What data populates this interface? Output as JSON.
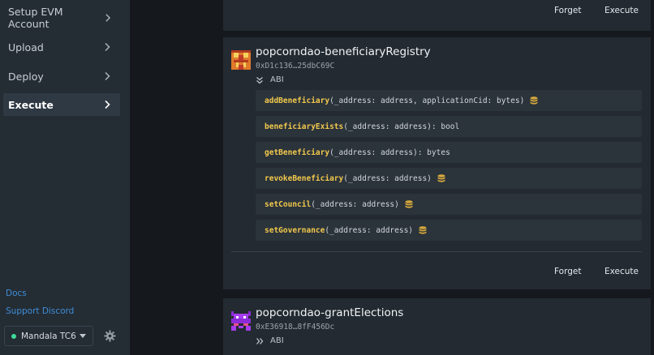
{
  "sidebar": {
    "nav": [
      {
        "label": "Setup EVM Account",
        "active": false
      },
      {
        "label": "Upload",
        "active": false
      },
      {
        "label": "Deploy",
        "active": false
      },
      {
        "label": "Execute",
        "active": true
      }
    ],
    "links": [
      "Docs",
      "Support Discord"
    ],
    "network": {
      "selected": "Mandala TC6"
    }
  },
  "actions": {
    "forget": "Forget",
    "execute": "Execute"
  },
  "contracts": [
    {
      "name": "popcorndao-beneficiaryRegistry",
      "address": "0xD1c136…25dbC69C",
      "abi_label": "ABI",
      "abi_expanded": true,
      "methods": [
        {
          "name": "addBeneficiary",
          "signature": "(_address: address, applicationCid: bytes)",
          "writes": true
        },
        {
          "name": "beneficiaryExists",
          "signature": "(_address: address): bool",
          "writes": false
        },
        {
          "name": "getBeneficiary",
          "signature": "(_address: address): bytes",
          "writes": false
        },
        {
          "name": "revokeBeneficiary",
          "signature": "(_address: address)",
          "writes": true
        },
        {
          "name": "setCouncil",
          "signature": "(_address: address)",
          "writes": true
        },
        {
          "name": "setGovernance",
          "signature": "(_address: address)",
          "writes": true
        }
      ]
    },
    {
      "name": "popcorndao-grantElections",
      "address": "0xE36918…8fF456Dc",
      "abi_label": "ABI",
      "abi_expanded": false
    }
  ],
  "colors": {
    "accent_link": "#3f8fd8",
    "method_name": "#f2c94c",
    "status_dot": "#3ddc97"
  },
  "icons": {
    "nav": "chevron-right-icon",
    "write": "database-icon",
    "settings": "gear-icon",
    "abi_open": "double-chevron-down-icon",
    "abi_closed": "double-chevron-right-icon"
  }
}
